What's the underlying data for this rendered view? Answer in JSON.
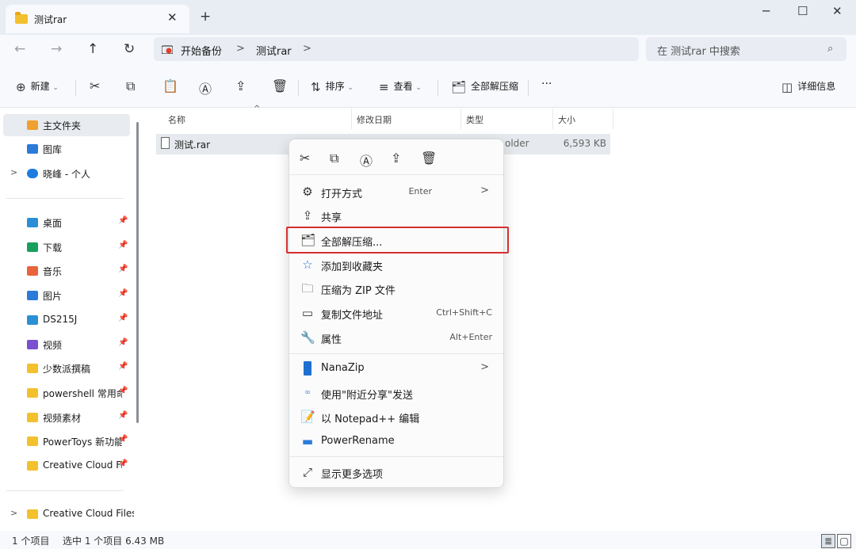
{
  "tab": {
    "title": "测试rar",
    "close": "✕",
    "new": "+"
  },
  "window": {
    "minimize": "─",
    "maximize": "☐",
    "close": "✕"
  },
  "nav": {
    "back": "←",
    "forward": "→",
    "up": "↑",
    "refresh": "↻"
  },
  "breadcrumb": {
    "root": "开始备份",
    "sep": ">",
    "current": "测试rar",
    "sep2": ">"
  },
  "search": {
    "placeholder": "在 测试rar 中搜索",
    "icon": "⌕"
  },
  "toolbar": {
    "new": "新建",
    "sort": "排序",
    "view": "查看",
    "extract_all": "全部解压缩",
    "more": "···",
    "details": "详细信息"
  },
  "sidebar": {
    "top": [
      {
        "label": "主文件夹",
        "icon": "home-icon",
        "color": "#f0a030"
      },
      {
        "label": "图库",
        "icon": "gallery-icon",
        "color": "#2b7bd9"
      },
      {
        "label": "晓峰 - 个人",
        "icon": "onedrive-icon",
        "color": "#1f7be0",
        "chevron": ">"
      }
    ],
    "quick": [
      {
        "label": "桌面",
        "color": "#2b8fd6"
      },
      {
        "label": "下载",
        "color": "#17a05d"
      },
      {
        "label": "音乐",
        "color": "#e8643a"
      },
      {
        "label": "图片",
        "color": "#2b7bd9"
      },
      {
        "label": "DS215J",
        "color": "#2b8fd6"
      },
      {
        "label": "视频",
        "color": "#7a4fd0"
      },
      {
        "label": "少数派撰稿",
        "color": "#f3c02e"
      },
      {
        "label": "powershell 常用命令",
        "color": "#f3c02e"
      },
      {
        "label": "视频素材",
        "color": "#f3c02e"
      },
      {
        "label": "PowerToys 新功能",
        "color": "#f3c02e"
      },
      {
        "label": "Creative Cloud Files",
        "color": "#f3c02e"
      }
    ],
    "bottom": {
      "label": "Creative Cloud Files",
      "chevron": ">"
    },
    "pin": "📌"
  },
  "columns": {
    "name": "名称",
    "date": "修改日期",
    "type": "类型",
    "size": "大小",
    "sort_caret": "^"
  },
  "files": [
    {
      "name": "测试.rar",
      "type": "older",
      "size": "6,593 KB"
    }
  ],
  "context_menu": {
    "top_actions": [
      "cut-icon",
      "copy-icon",
      "rename-icon",
      "share-icon",
      "delete-icon"
    ],
    "items": [
      {
        "label": "打开方式",
        "shortcut": "Enter",
        "submenu": ">"
      },
      {
        "label": "共享",
        "shortcut": "",
        "submenu": ""
      },
      {
        "label": "全部解压缩...",
        "shortcut": "",
        "submenu": ""
      },
      {
        "label": "添加到收藏夹",
        "shortcut": "",
        "submenu": ""
      },
      {
        "label": "压缩为 ZIP 文件",
        "shortcut": "",
        "submenu": ""
      },
      {
        "label": "复制文件地址",
        "shortcut": "Ctrl+Shift+C",
        "submenu": ""
      },
      {
        "label": "属性",
        "shortcut": "Alt+Enter",
        "submenu": ""
      },
      {
        "label": "NanaZip",
        "shortcut": "",
        "submenu": ">"
      },
      {
        "label": "使用\"附近分享\"发送",
        "shortcut": "",
        "submenu": ""
      },
      {
        "label": "以 Notepad++ 编辑",
        "shortcut": "",
        "submenu": ""
      },
      {
        "label": "PowerRename",
        "shortcut": "",
        "submenu": ""
      },
      {
        "label": "显示更多选项",
        "shortcut": "",
        "submenu": ""
      }
    ]
  },
  "status": {
    "count": "1 个项目",
    "selected": "选中 1 个项目  6.43 MB"
  }
}
